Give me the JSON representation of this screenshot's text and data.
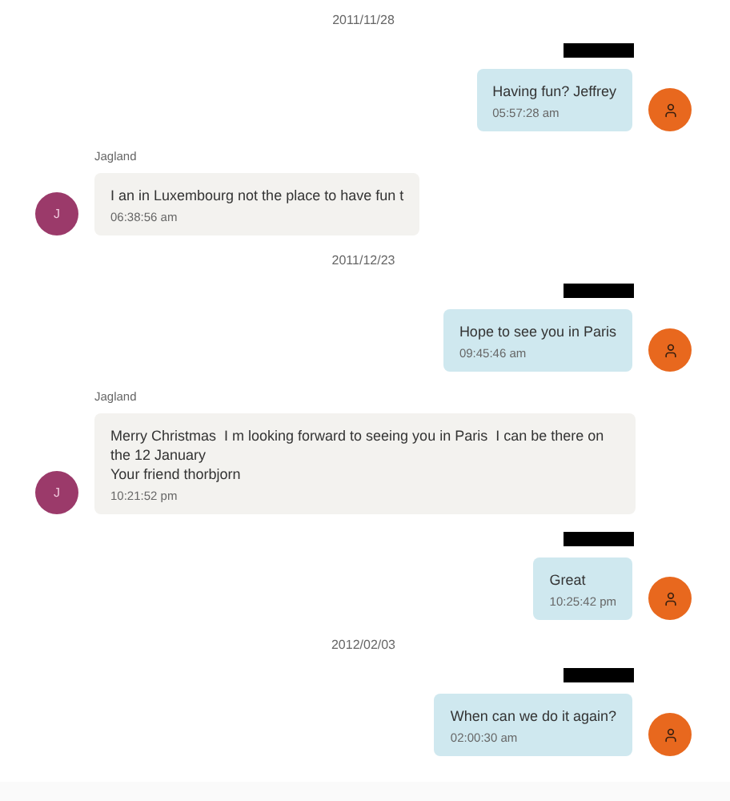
{
  "conversation": [
    {
      "kind": "date",
      "text": "2011/11/28"
    },
    {
      "kind": "outgoing",
      "sender_redacted": true,
      "text": "Having fun? Jeffrey",
      "time": "05:57:28 am"
    },
    {
      "kind": "incoming",
      "sender": "Jagland",
      "avatar_initial": "J",
      "text": "I an in Luxembourg not the place to have fun t",
      "time": "06:38:56 am"
    },
    {
      "kind": "date",
      "text": "2011/12/23"
    },
    {
      "kind": "outgoing",
      "sender_redacted": true,
      "text": "Hope to see you in Paris",
      "time": "09:45:46 am"
    },
    {
      "kind": "incoming",
      "sender": "Jagland",
      "avatar_initial": "J",
      "text": "Merry Christmas  I m looking forward to seeing you in Paris  I can be there on the 12 January\nYour friend thorbjorn",
      "time": "10:21:52 pm"
    },
    {
      "kind": "outgoing",
      "sender_redacted": true,
      "text": "Great",
      "time": "10:25:42 pm"
    },
    {
      "kind": "date",
      "text": "2012/02/03"
    },
    {
      "kind": "outgoing",
      "sender_redacted": true,
      "text": "When can we do it again?",
      "time": "02:00:30 am"
    }
  ]
}
